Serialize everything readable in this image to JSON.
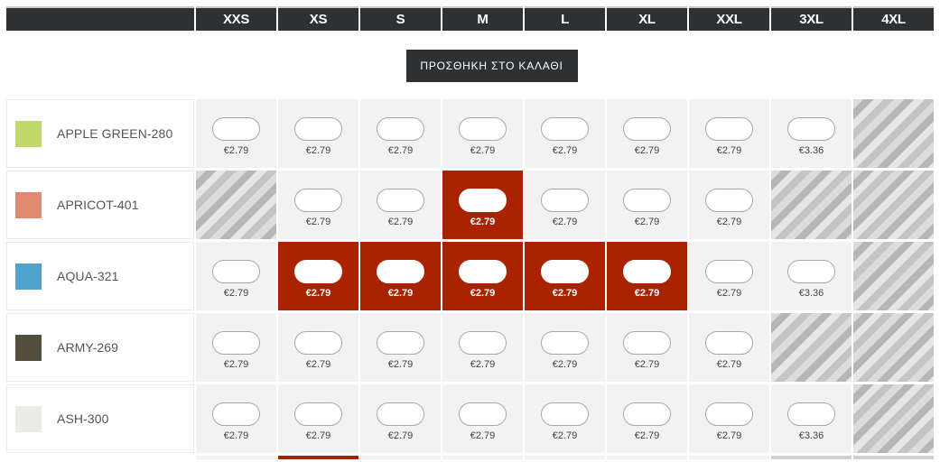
{
  "header": {
    "sizes": [
      "XXS",
      "XS",
      "S",
      "M",
      "L",
      "XL",
      "XXL",
      "3XL",
      "4XL"
    ]
  },
  "actions": {
    "add_to_cart_label": "ΠΡΟΣΘΗΚΗ ΣΤΟ ΚΑΛΑΘΙ"
  },
  "rows": [
    {
      "color": "APPLE GREEN-280",
      "swatch": "#c0d96b",
      "cells": [
        {
          "state": "available",
          "price": "€2.79",
          "value": ""
        },
        {
          "state": "available",
          "price": "€2.79",
          "value": ""
        },
        {
          "state": "available",
          "price": "€2.79",
          "value": ""
        },
        {
          "state": "available",
          "price": "€2.79",
          "value": ""
        },
        {
          "state": "available",
          "price": "€2.79",
          "value": ""
        },
        {
          "state": "available",
          "price": "€2.79",
          "value": ""
        },
        {
          "state": "available",
          "price": "€2.79",
          "value": ""
        },
        {
          "state": "available",
          "price": "€3.36",
          "value": ""
        },
        {
          "state": "unavailable"
        }
      ]
    },
    {
      "color": "APRICOT-401",
      "swatch": "#e28a70",
      "cells": [
        {
          "state": "unavailable"
        },
        {
          "state": "available",
          "price": "€2.79",
          "value": ""
        },
        {
          "state": "available",
          "price": "€2.79",
          "value": ""
        },
        {
          "state": "selected",
          "price": "€2.79",
          "value": ""
        },
        {
          "state": "available",
          "price": "€2.79",
          "value": ""
        },
        {
          "state": "available",
          "price": "€2.79",
          "value": ""
        },
        {
          "state": "available",
          "price": "€2.79",
          "value": ""
        },
        {
          "state": "unavailable"
        },
        {
          "state": "unavailable"
        }
      ]
    },
    {
      "color": "AQUA-321",
      "swatch": "#4fa3cc",
      "cells": [
        {
          "state": "available",
          "price": "€2.79",
          "value": ""
        },
        {
          "state": "selected",
          "price": "€2.79",
          "value": ""
        },
        {
          "state": "selected",
          "price": "€2.79",
          "value": ""
        },
        {
          "state": "selected",
          "price": "€2.79",
          "value": ""
        },
        {
          "state": "selected",
          "price": "€2.79",
          "value": ""
        },
        {
          "state": "selected",
          "price": "€2.79",
          "value": ""
        },
        {
          "state": "available",
          "price": "€2.79",
          "value": ""
        },
        {
          "state": "available",
          "price": "€3.36",
          "value": ""
        },
        {
          "state": "unavailable"
        }
      ]
    },
    {
      "color": "ARMY-269",
      "swatch": "#534f3e",
      "cells": [
        {
          "state": "available",
          "price": "€2.79",
          "value": ""
        },
        {
          "state": "available",
          "price": "€2.79",
          "value": ""
        },
        {
          "state": "available",
          "price": "€2.79",
          "value": ""
        },
        {
          "state": "available",
          "price": "€2.79",
          "value": ""
        },
        {
          "state": "available",
          "price": "€2.79",
          "value": ""
        },
        {
          "state": "available",
          "price": "€2.79",
          "value": ""
        },
        {
          "state": "available",
          "price": "€2.79",
          "value": ""
        },
        {
          "state": "unavailable"
        },
        {
          "state": "unavailable"
        }
      ]
    },
    {
      "color": "ASH-300",
      "swatch": "#ebebe8",
      "cells": [
        {
          "state": "available",
          "price": "€2.79",
          "value": ""
        },
        {
          "state": "available",
          "price": "€2.79",
          "value": ""
        },
        {
          "state": "available",
          "price": "€2.79",
          "value": ""
        },
        {
          "state": "available",
          "price": "€2.79",
          "value": ""
        },
        {
          "state": "available",
          "price": "€2.79",
          "value": ""
        },
        {
          "state": "available",
          "price": "€2.79",
          "value": ""
        },
        {
          "state": "available",
          "price": "€2.79",
          "value": ""
        },
        {
          "state": "available",
          "price": "€3.36",
          "value": ""
        },
        {
          "state": "unavailable"
        }
      ]
    }
  ],
  "next_row_partial": [
    "available",
    "selected",
    "available",
    "available",
    "available",
    "available",
    "available",
    "unavailable",
    "unavailable"
  ],
  "colors": {
    "header_bg": "#2e3134",
    "selected_bg": "#aa2300",
    "cell_bg": "#f2f2f2"
  }
}
